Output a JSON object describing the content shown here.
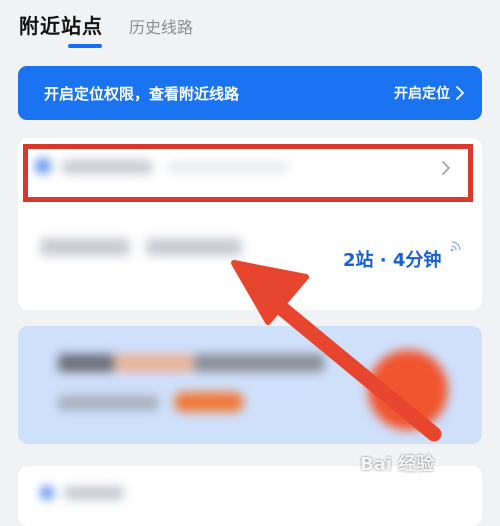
{
  "tabs": {
    "active": "附近站点",
    "inactive": "历史线路"
  },
  "banner": {
    "text": "开启定位权限，查看附近线路",
    "action": "开启定位"
  },
  "station_card": {
    "eta": "2站 · 4分钟"
  },
  "watermark": {
    "text": "Bai 经验"
  },
  "colors": {
    "accent": "#1a73f0",
    "highlight": "#d9392c",
    "arrow": "#e8452f"
  },
  "icons": {
    "chevron": "chevron-right-icon",
    "signal": "realtime-signal-icon"
  }
}
